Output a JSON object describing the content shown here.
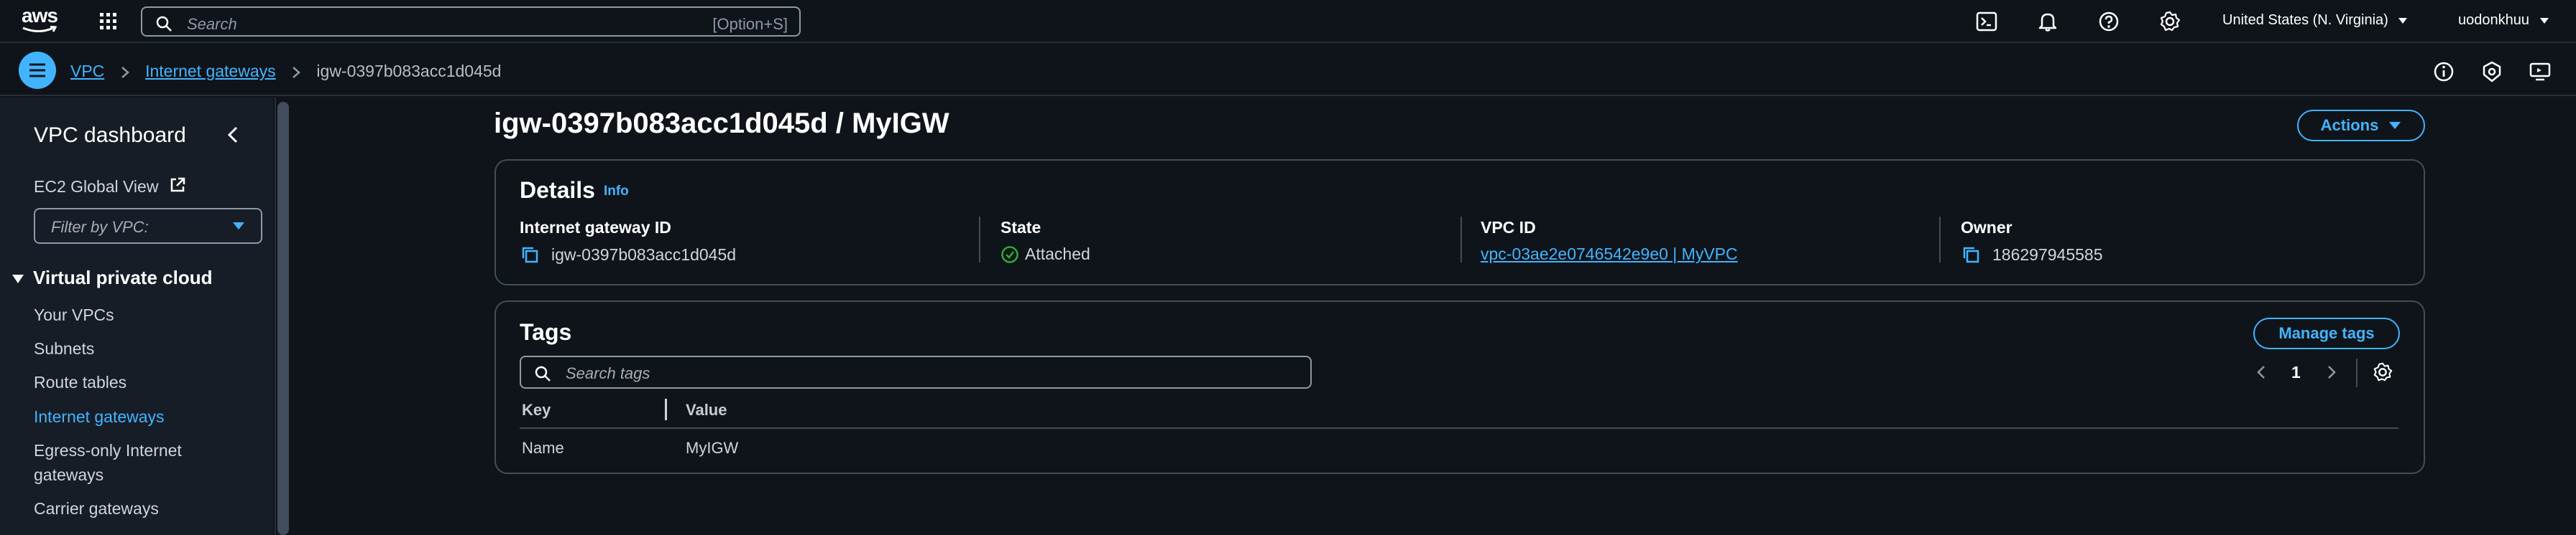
{
  "topbar": {
    "logo_text": "aws",
    "search_placeholder": "Search",
    "search_shortcut": "[Option+S]",
    "region": "United States (N. Virginia)",
    "user": "uodonkhuu",
    "icons": [
      "grid-icon",
      "cloudshell-icon",
      "bell-icon",
      "help-icon",
      "settings-icon"
    ]
  },
  "breadcrumb": {
    "items": [
      "VPC",
      "Internet gateways"
    ],
    "current": "igw-0397b083acc1d045d",
    "icons": [
      "info-circle-icon",
      "shield-icon",
      "display-icon"
    ]
  },
  "sidebar": {
    "title": "VPC dashboard",
    "ec2_global_view": "EC2 Global View",
    "filter_placeholder": "Filter by VPC:",
    "section": "Virtual private cloud",
    "items": [
      "Your VPCs",
      "Subnets",
      "Route tables",
      "Internet gateways",
      "Egress-only Internet",
      "gateways",
      "Carrier gateways"
    ],
    "active_item": "Internet gateways"
  },
  "main": {
    "title": "igw-0397b083acc1d045d / MyIGW",
    "actions_label": "Actions"
  },
  "details": {
    "title": "Details",
    "info": "Info",
    "fields": [
      {
        "label": "Internet gateway ID",
        "value": "igw-0397b083acc1d045d"
      },
      {
        "label": "State",
        "value": "Attached"
      },
      {
        "label": "VPC ID",
        "value": "vpc-03ae2e0746542e9e0 | MyVPC"
      },
      {
        "label": "Owner",
        "value": "186297945585"
      }
    ]
  },
  "tags": {
    "title": "Tags",
    "manage_label": "Manage tags",
    "search_placeholder": "Search tags",
    "page": "1",
    "columns": [
      "Key",
      "Value"
    ],
    "rows": [
      {
        "key": "Name",
        "value": "MyIGW"
      }
    ]
  },
  "colors": {
    "accent": "#42b4ff",
    "success": "#29ad32",
    "background": "#0f141a",
    "sidebar": "#161d26",
    "border": "#414d5c"
  }
}
